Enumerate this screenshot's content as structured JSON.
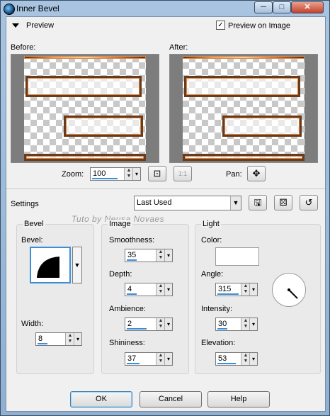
{
  "window": {
    "title": "Inner Bevel",
    "controls": {
      "minimize": "─",
      "maximize": "□",
      "close": "✕"
    }
  },
  "preview": {
    "header": "Preview",
    "preview_on_image": {
      "label": "Preview on Image",
      "checked": true
    },
    "before_label": "Before:",
    "after_label": "After:",
    "zoom": {
      "label": "Zoom:",
      "value": "100"
    },
    "pan_label": "Pan:",
    "one_to_one": "1:1"
  },
  "settings": {
    "label": "Settings",
    "preset": "Last Used"
  },
  "watermark": "Tuto by  Neusa Novaes",
  "bevel": {
    "title": "Bevel",
    "bevel_label": "Bevel:",
    "width": {
      "label": "Width:",
      "value": "8"
    }
  },
  "image": {
    "title": "Image",
    "smoothness": {
      "label": "Smoothness:",
      "value": "35"
    },
    "depth": {
      "label": "Depth:",
      "value": "4"
    },
    "ambience": {
      "label": "Ambience:",
      "value": "2"
    },
    "shininess": {
      "label": "Shininess:",
      "value": "37"
    }
  },
  "light": {
    "title": "Light",
    "color": {
      "label": "Color:",
      "value": "#ffffff"
    },
    "angle": {
      "label": "Angle:",
      "value": "315"
    },
    "intensity": {
      "label": "Intensity:",
      "value": "30"
    },
    "elevation": {
      "label": "Elevation:",
      "value": "53"
    }
  },
  "buttons": {
    "ok": "OK",
    "cancel": "Cancel",
    "help": "Help"
  }
}
